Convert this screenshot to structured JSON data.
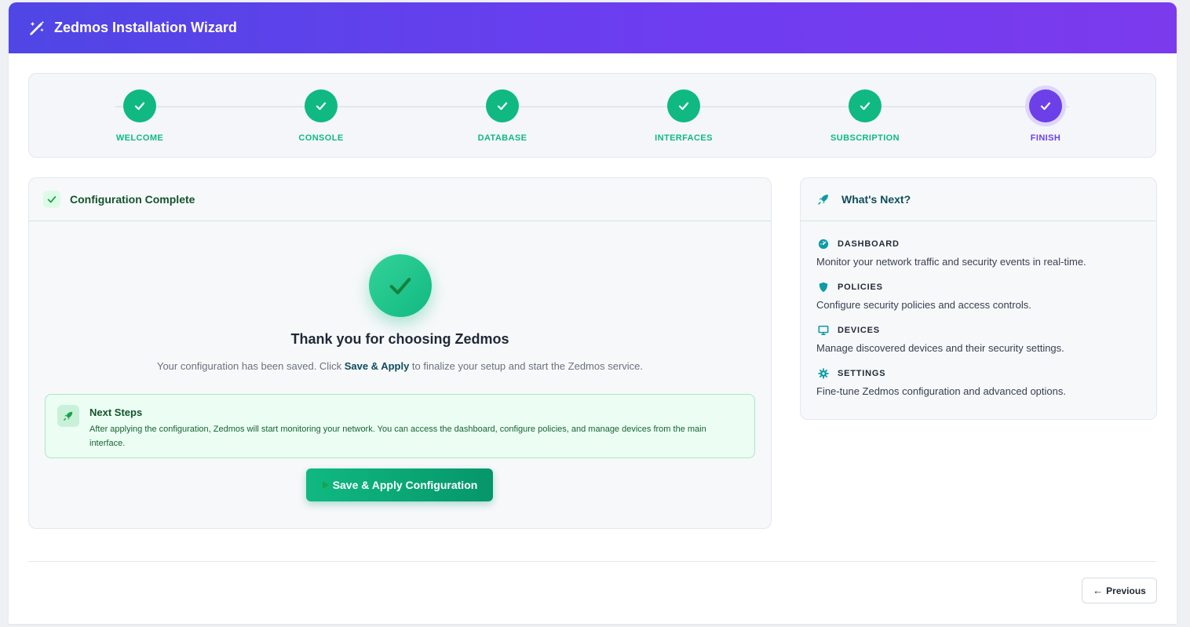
{
  "header": {
    "title": "Zedmos Installation Wizard",
    "icon": "magic-wand-icon"
  },
  "steps": [
    {
      "label": "WELCOME",
      "status": "done"
    },
    {
      "label": "CONSOLE",
      "status": "done"
    },
    {
      "label": "DATABASE",
      "status": "done"
    },
    {
      "label": "INTERFACES",
      "status": "done"
    },
    {
      "label": "SUBSCRIPTION",
      "status": "done"
    },
    {
      "label": "FINISH",
      "status": "active"
    }
  ],
  "main": {
    "title": "Configuration Complete",
    "thanks": "Thank you for choosing Zedmos",
    "saved_prefix": "Your configuration has been saved. Click ",
    "saved_bold": "Save & Apply",
    "saved_suffix": " to finalize your setup and start the Zedmos service.",
    "next_title": "Next Steps",
    "next_text": "After applying the configuration, Zedmos will start monitoring your network. You can access the dashboard, configure policies, and manage devices from the main interface.",
    "apply_label": "Save & Apply Configuration"
  },
  "side": {
    "title": "What's Next?",
    "items": [
      {
        "name": "DASHBOARD",
        "desc": "Monitor your network traffic and security events in real-time.",
        "icon": "gauge-icon"
      },
      {
        "name": "POLICIES",
        "desc": "Configure security policies and access controls.",
        "icon": "shield-icon"
      },
      {
        "name": "DEVICES",
        "desc": "Manage discovered devices and their security settings.",
        "icon": "monitor-icon"
      },
      {
        "name": "SETTINGS",
        "desc": "Fine-tune Zedmos configuration and advanced options.",
        "icon": "gear-icon"
      }
    ]
  },
  "footer": {
    "previous_label": "Previous"
  },
  "colors": {
    "accent": "#6d3fe8",
    "success": "#10b981",
    "teal": "#0e9aa7"
  }
}
